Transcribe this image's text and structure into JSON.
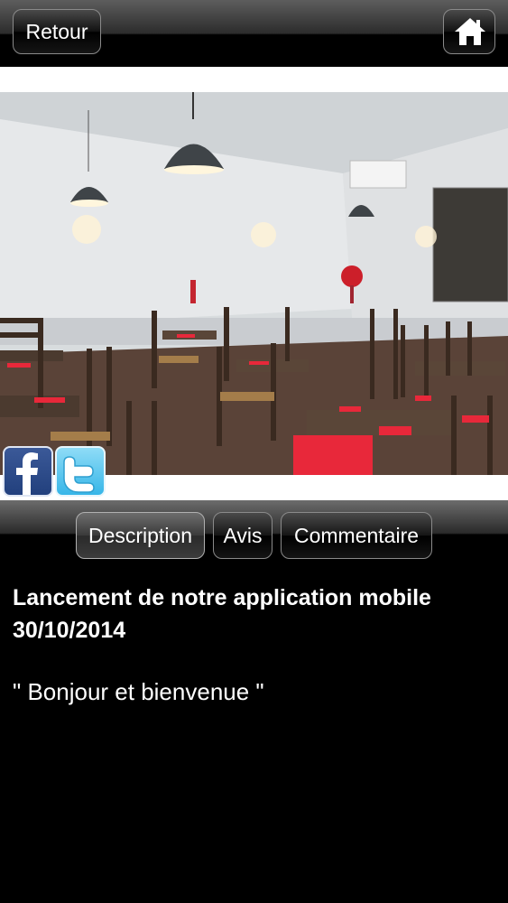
{
  "header": {
    "back_label": "Retour",
    "home_icon": "home-icon"
  },
  "photo": {
    "subject": "restaurant-dining-room"
  },
  "social": {
    "facebook_icon": "facebook-icon",
    "twitter_icon": "twitter-icon"
  },
  "tabs": [
    {
      "label": "Description",
      "active": true
    },
    {
      "label": "Avis",
      "active": false
    },
    {
      "label": "Commentaire",
      "active": false
    }
  ],
  "content": {
    "title_line1": "Lancement de notre application mobile",
    "title_line2": "30/10/2014",
    "greeting": "\" Bonjour et bienvenue \""
  },
  "colors": {
    "background": "#000000",
    "tablecloth_red": "#e8283a",
    "facebook_blue": "#3b5998",
    "twitter_blue": "#55c4ee"
  }
}
